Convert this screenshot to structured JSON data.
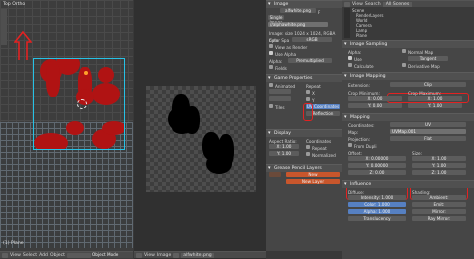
{
  "viewport": {
    "title": "Top Ortho",
    "footer_label": "(1) Plane",
    "mode": "Object Mode"
  },
  "image_editor": {
    "image_name": "alfwhite.png",
    "menu_view": "View",
    "menu_image": "Image"
  },
  "image_panel": {
    "header": "Image",
    "image_field": "alfwhite.png",
    "filepath": "//alphawhite.png",
    "info": "Image: size 1024 x 1024, RGBA byte",
    "color_space_label": "Color Spa",
    "color_space_value": "sRGB",
    "view_as_render": "View as Render",
    "use_alpha": "Use Alpha",
    "alpha_label": "Alpha:",
    "alpha_value": "Premultiplied",
    "fields_label": "Fields",
    "game_props_header": "Game Properties",
    "animated": "Animated",
    "tiles": "Tiles",
    "repeat_label": "Repeat",
    "repeat_x": "X",
    "repeat_y": "Y",
    "uv_coordinates": "UV Coordinates",
    "reflection": "Reflection",
    "display_header": "Display",
    "aspect_ratio": "Aspect Ratio:",
    "coordinates": "Coordinates",
    "aspect_x": "X: 1.00",
    "aspect_y": "Y: 1.00",
    "repeat_opt": "Repeat",
    "normalized": "Normalized",
    "grease_pencil_header": "Grease Pencil Layers",
    "new_button": "New",
    "new_layer_button": "New Layer"
  },
  "outliner": {
    "view": "View",
    "search": "Search",
    "all_scenes": "All Scenes",
    "items": [
      "Scene",
      "RenderLayers",
      "World",
      "Camera",
      "Lamp",
      "Plane"
    ]
  },
  "texture_props": {
    "image_sampling": "Image Sampling",
    "alpha_label": "Alpha:",
    "use_alpha": "Use",
    "calculate": "Calculate",
    "normal_map": "Normal Map",
    "tangent": "Tangent",
    "derivative_map": "Derivative Map",
    "image_mapping_header": "Image Mapping",
    "extension_label": "Extension:",
    "extension_value": "Clip",
    "crop_min": "Crop Minimum:",
    "crop_max": "Crop Maximum:",
    "crop_x_min": "X:",
    "crop_x_min_val": "0.00",
    "crop_x_max_val": "1.00",
    "crop_y_min_val": "0.00",
    "crop_y_max_val": "1.00",
    "mapping_header": "Mapping",
    "coordinates_label": "Coordinates:",
    "coordinates_value": "UV",
    "map_label": "Map:",
    "map_value": "UVMap.001",
    "projection_label": "Projection:",
    "projection_value": "Flat",
    "from_dupli": "From Dupli",
    "offset_label": "Offset:",
    "size_label": "Size:",
    "offset_x": "0.00000",
    "offset_y": "0.00000",
    "offset_z": "0.00",
    "size_x": "1.00",
    "size_y": "1.00",
    "size_z": "1.00",
    "influence_header": "Influence",
    "diffuse_label": "Diffuse:",
    "shading_label": "Shading:",
    "intensity": "Intensity:",
    "color": "Color:",
    "alpha": "Alpha:",
    "translucency": "Translucency",
    "ambient": "Ambient:",
    "emit": "Emit:",
    "mirror": "Mirror:",
    "ray_mirror": "Ray Mirror:",
    "intensity_val": "1.000",
    "color_val": "1.000",
    "alpha_val": "1.000"
  },
  "colors": {
    "accent_blue": "#5680c2",
    "highlight_red": "#e22222",
    "blob_red": "#b01313"
  }
}
